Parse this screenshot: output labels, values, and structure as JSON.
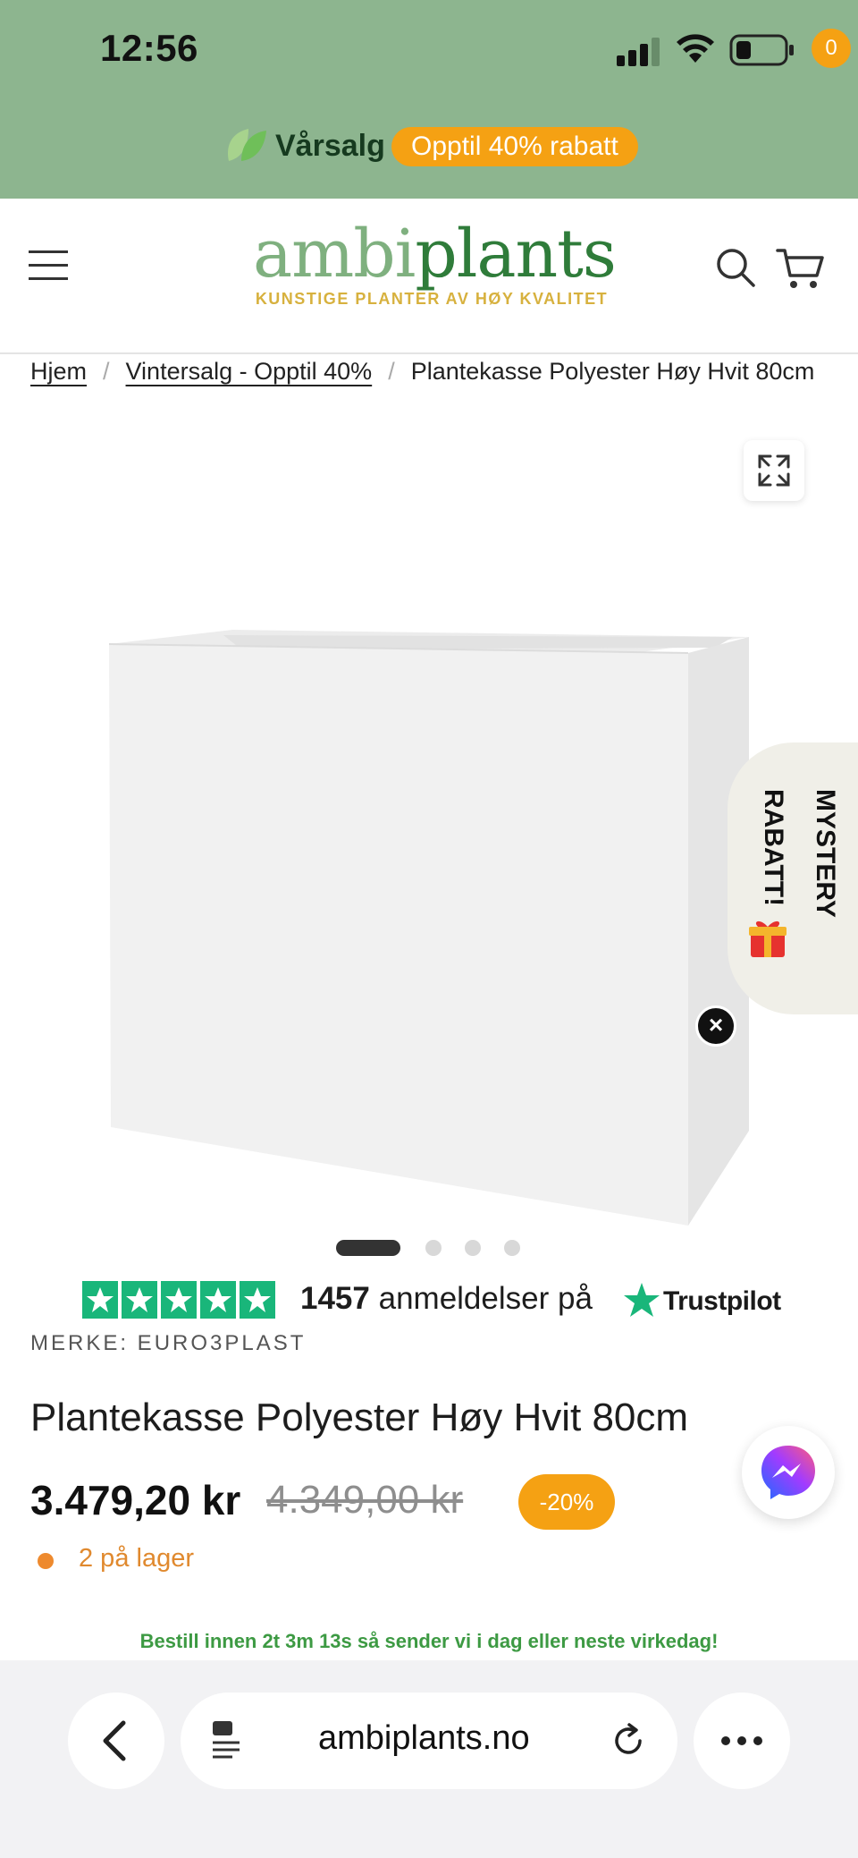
{
  "status_bar": {
    "time": "12:56"
  },
  "promo": {
    "label": "Vårsalg",
    "pill": "Opptil 40% rabatt"
  },
  "header": {
    "logo_part1": "ambi",
    "logo_part2": "plants",
    "tagline": "KUNSTIGE PLANTER AV HØY KVALITET",
    "cart_count": "0"
  },
  "breadcrumb": {
    "home": "Hjem",
    "category": "Vintersalg - Opptil 40%",
    "current": "Plantekasse Polyester Høy Hvit 80cm"
  },
  "gallery": {
    "dots_total": 4,
    "active_index": 0
  },
  "mystery": {
    "line1": "MYSTERY",
    "line2": "RABATT!"
  },
  "reviews": {
    "count": "1457",
    "text": "anmeldelser på",
    "platform": "Trustpilot",
    "stars": 5
  },
  "product": {
    "brand": "MERKE: EURO3PLAST",
    "title": "Plantekasse Polyester Høy Hvit 80cm",
    "price": "3.479,20 kr",
    "old_price": "4.349,00 kr",
    "discount": "-20%",
    "stock": "2 på lager",
    "order_note": "Bestill innen 2t 3m 13s så sender vi i dag eller neste virkedag!"
  },
  "browser": {
    "url": "ambiplants.no"
  },
  "colors": {
    "top_band": "#8db58f",
    "accent_orange": "#f5a113",
    "trustpilot_green": "#19b67a",
    "brand_green": "#2f7c3a"
  }
}
